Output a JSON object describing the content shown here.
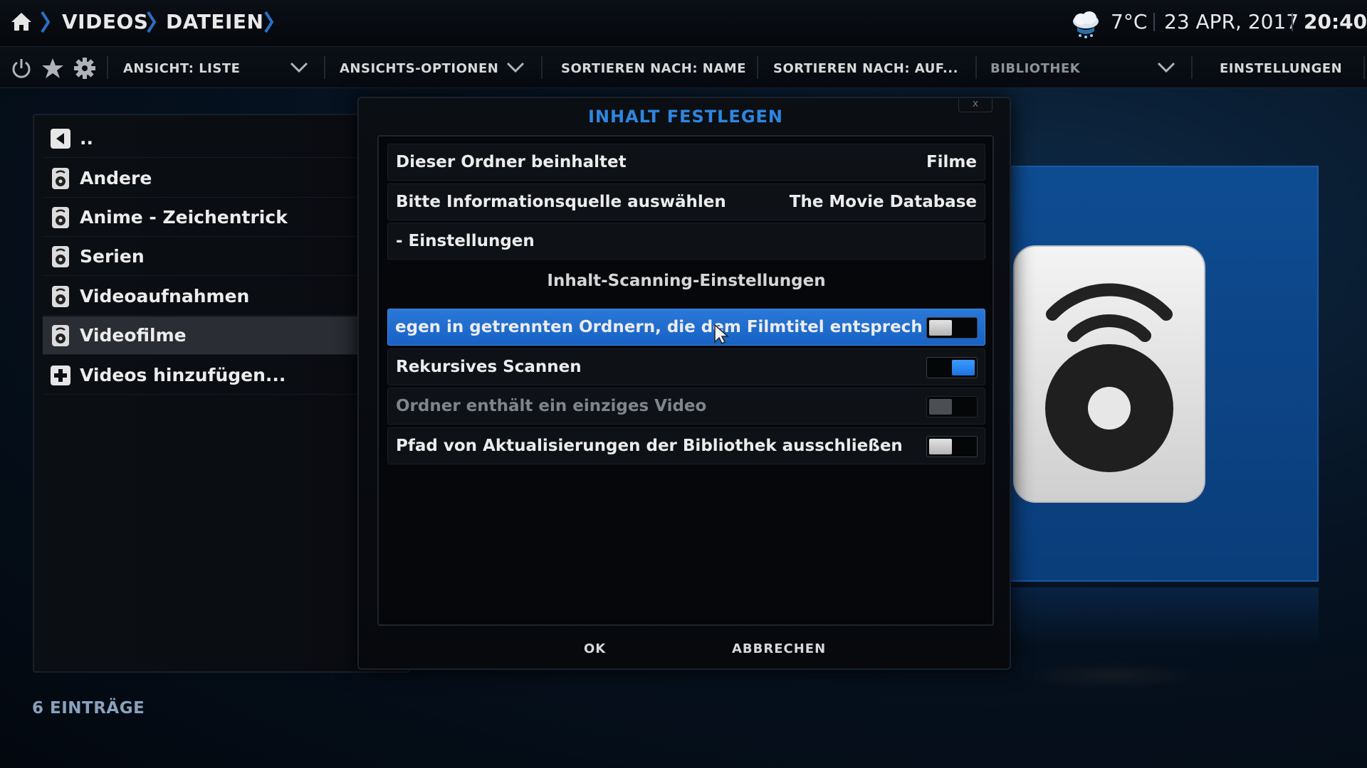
{
  "header": {
    "breadcrumb": [
      "VIDEOS",
      "DATEIEN"
    ],
    "temperature": "7°C",
    "date": "23 APR, 2017",
    "time": "20:40",
    "weather_icon": "cloud-snow-icon"
  },
  "toolbar": {
    "view": "ANSICHT: LISTE",
    "view_options": "ANSICHTS-OPTIONEN",
    "sort_by": "SORTIEREN NACH: NAME",
    "sort_order": "SORTIEREN NACH: AUF...",
    "library": "BIBLIOTHEK",
    "settings": "EINSTELLUNGEN"
  },
  "file_list": {
    "items": [
      {
        "label": "..",
        "icon": "back-arrow-icon"
      },
      {
        "label": "Andere",
        "icon": "speaker-icon"
      },
      {
        "label": "Anime - Zeichentrick",
        "icon": "speaker-icon"
      },
      {
        "label": "Serien",
        "icon": "speaker-icon"
      },
      {
        "label": "Videoaufnahmen",
        "icon": "speaker-icon"
      },
      {
        "label": "Videofilme",
        "icon": "speaker-icon",
        "selected": true
      },
      {
        "label": "Videos hinzufügen...",
        "icon": "plus-icon"
      }
    ],
    "count": "6 EINTRÄGE"
  },
  "dialog": {
    "title": "INHALT FESTLEGEN",
    "close": "x",
    "rows": [
      {
        "label": "Dieser Ordner beinhaltet",
        "value": "Filme"
      },
      {
        "label": "Bitte Informationsquelle auswählen",
        "value": "The Movie Database"
      },
      {
        "label": "- Einstellungen"
      }
    ],
    "section_header": "Inhalt-Scanning-Einstellungen",
    "toggles": [
      {
        "label": "egen in getrennten Ordnern, die dem Filmtitel entsprechen | I",
        "state": "off",
        "focused": true
      },
      {
        "label": "Rekursives Scannen",
        "state": "on"
      },
      {
        "label": "Ordner enthält ein einziges Video",
        "state": "off",
        "disabled": true
      },
      {
        "label": "Pfad von Aktualisierungen der Bibliothek ausschließen",
        "state": "off"
      }
    ],
    "ok": "OK",
    "cancel": "ABBRECHEN"
  },
  "colors": {
    "accent": "#2e86e0",
    "focus": "#1f6fd0",
    "preview_bg": "#0e4c92"
  }
}
